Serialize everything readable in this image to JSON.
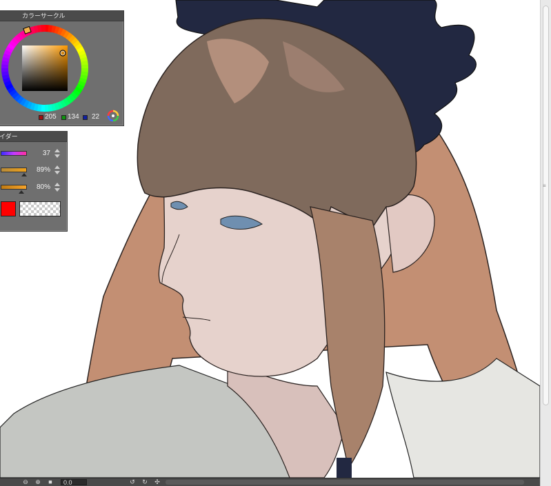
{
  "color_circle": {
    "title": "カラーサークル",
    "rgb": {
      "r": "205",
      "g": "134",
      "b": "22"
    },
    "rgb_colors": {
      "r": "#a01010",
      "g": "#109010",
      "b": "#1020a0"
    },
    "icon": "color-wheel-icon"
  },
  "color_slider": {
    "title": "イダー",
    "rows": [
      {
        "name": "hue",
        "value": "37",
        "fraction": 0.1
      },
      {
        "name": "saturation",
        "value": "89%",
        "fraction": 0.89
      },
      {
        "name": "brightness",
        "value": "80%",
        "fraction": 0.8
      }
    ],
    "main_color": "#ff0000",
    "sub_color": "transparent"
  },
  "status_bar": {
    "coordinates": "0.0",
    "icons": [
      "zoom-out-icon",
      "zoom-in-icon",
      "fit-icon",
      "rotate-left-icon",
      "rotate-right-icon",
      "reset-rotation-icon"
    ]
  },
  "canvas": {
    "content": "digital-painting",
    "colors": {
      "hair": "#7f6a5c",
      "hair_light": "#c9a08a",
      "long_hair": "#c38f73",
      "skin": "#e6d2cc",
      "shirt": "#c4c6c2",
      "bow": "#222841"
    }
  }
}
